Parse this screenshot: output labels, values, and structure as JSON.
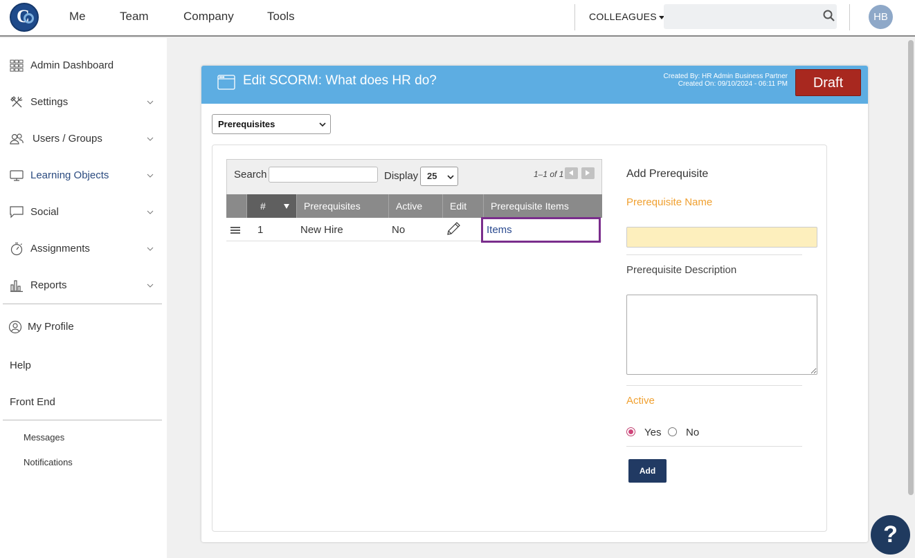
{
  "topbar": {
    "nav": [
      "Me",
      "Team",
      "Company",
      "Tools"
    ],
    "colleagues_label": "COLLEAGUES",
    "search_placeholder": "",
    "avatar_initials": "HB"
  },
  "sidebar": {
    "items": [
      {
        "label": "Admin Dashboard",
        "icon": "grid-icon"
      },
      {
        "label": "Settings",
        "icon": "tools-icon"
      },
      {
        "label": "Users / Groups",
        "icon": "users-icon"
      },
      {
        "label": "Learning Objects",
        "icon": "monitor-icon",
        "active": true
      },
      {
        "label": "Social",
        "icon": "chat-bubble-icon"
      },
      {
        "label": "Assignments",
        "icon": "stopwatch-icon"
      },
      {
        "label": "Reports",
        "icon": "bar-chart-icon"
      }
    ],
    "my_profile": "My Profile",
    "help": "Help",
    "front_end": "Front End",
    "messages": "Messages",
    "notifications": "Notifications"
  },
  "card": {
    "title": "Edit SCORM: What does HR do?",
    "created_by": "Created By: HR Admin Business Partner",
    "created_on": "Created On: 09/10/2024 - 06:11 PM",
    "status_button": "Draft",
    "section_select": "Prerequisites"
  },
  "table": {
    "search_label": "Search",
    "search_value": "",
    "display_label": "Display",
    "display_value": "25",
    "page_info": "1–1 of 1",
    "columns": [
      "#",
      "Prerequisites",
      "Active",
      "Edit",
      "Prerequisite Items"
    ],
    "rows": [
      {
        "num": "1",
        "name": "New Hire",
        "active": "No",
        "items": "Items"
      }
    ]
  },
  "form": {
    "title": "Add Prerequisite",
    "name_label": "Prerequisite Name",
    "name_value": "",
    "description_label": "Prerequisite Description",
    "description_value": "",
    "active_label": "Active",
    "yes_label": "Yes",
    "no_label": "No",
    "active_selected": "Yes",
    "add_button": "Add"
  },
  "help_button": "?",
  "colors": {
    "header_blue": "#5dade2",
    "draft_red": "#a8281f",
    "navy": "#213a63",
    "orange_label": "#f0a030",
    "highlight_purple": "#7a2d8c",
    "input_yellow": "#fdefbd"
  }
}
